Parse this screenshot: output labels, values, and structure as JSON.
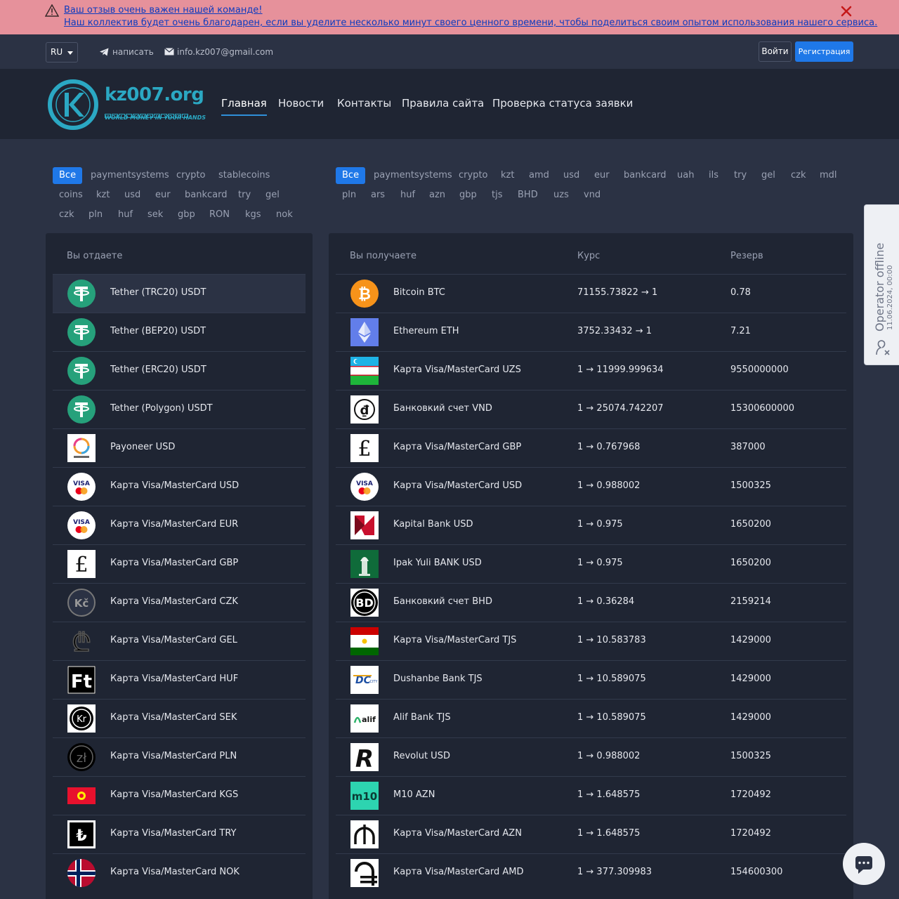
{
  "alert": {
    "line1": "Ваш отзыв очень важен нашей команде!",
    "line2": "Наш коллектив будет очень благодарен, если вы уделите несколько минут своего ценного времени, чтобы поделиться своим опытом использования нашего сервиса."
  },
  "topbar": {
    "lang": "RU",
    "write": "написать",
    "email": "info.kz007@gmail.com",
    "login": "Войти",
    "register": "Регистрация"
  },
  "logo": {
    "name": "kz007.org",
    "slogan": "WORLD MONEY IN YOUR HANDS"
  },
  "nav": [
    "Главная",
    "Новости",
    "Контакты",
    "Правила сайта",
    "Проверка статуса заявки"
  ],
  "filters_left": [
    "Все",
    "paymentsystems",
    "crypto",
    "stablecoins",
    "coins",
    "kzt",
    "usd",
    "eur",
    "bankcard",
    "try",
    "gel",
    "czk",
    "pln",
    "huf",
    "sek",
    "gbp",
    "RON",
    "kgs",
    "nok"
  ],
  "filters_right": [
    "Все",
    "paymentsystems",
    "crypto",
    "kzt",
    "amd",
    "usd",
    "eur",
    "bankcard",
    "uah",
    "ils",
    "try",
    "gel",
    "czk",
    "mdl",
    "pln",
    "ars",
    "huf",
    "azn",
    "gbp",
    "tjs",
    "BHD",
    "uzs",
    "vnd"
  ],
  "give": {
    "header": "Вы отдаете",
    "items": [
      "Tether (TRC20) USDT",
      "Tether (BEP20) USDT",
      "Tether (ERC20) USDT",
      "Tether (Polygon) USDT",
      "Payoneer USD",
      "Карта Visa/MasterCard USD",
      "Карта Visa/MasterCard EUR",
      "Карта Visa/MasterCard GBP",
      "Карта Visa/MasterCard CZK",
      "Карта Visa/MasterCard GEL",
      "Карта Visa/MasterCard HUF",
      "Карта Visa/MasterCard SEK",
      "Карта Visa/MasterCard PLN",
      "Карта Visa/MasterCard KGS",
      "Карта Visa/MasterCard TRY",
      "Карта Visa/MasterCard NOK"
    ]
  },
  "receive": {
    "header_name": "Вы получаете",
    "header_rate": "Курс",
    "header_reserve": "Резерв",
    "rows": [
      {
        "name": "Bitcoin BTC",
        "rate": "71155.73822 → 1",
        "reserve": "0.78"
      },
      {
        "name": "Ethereum ETH",
        "rate": "3752.33432 → 1",
        "reserve": "7.21"
      },
      {
        "name": "Карта Visa/MasterCard UZS",
        "rate": "1 → 11999.999634",
        "reserve": "9550000000"
      },
      {
        "name": "Банковкий счет VND",
        "rate": "1 → 25074.742207",
        "reserve": "15300600000"
      },
      {
        "name": "Карта Visa/MasterCard GBP",
        "rate": "1 → 0.767968",
        "reserve": "387000"
      },
      {
        "name": "Карта Visa/MasterCard USD",
        "rate": "1 → 0.988002",
        "reserve": "1500325"
      },
      {
        "name": "Kapital Bank USD",
        "rate": "1 → 0.975",
        "reserve": "1650200"
      },
      {
        "name": "Ipak Yuli BANK USD",
        "rate": "1 → 0.975",
        "reserve": "1650200"
      },
      {
        "name": "Банковкий счет BHD",
        "rate": "1 → 0.36284",
        "reserve": "2159214"
      },
      {
        "name": "Карта Visa/MasterCard TJS",
        "rate": "1 → 10.583783",
        "reserve": "1429000"
      },
      {
        "name": "Dushanbe Bank TJS",
        "rate": "1 → 10.589075",
        "reserve": "1429000"
      },
      {
        "name": "Alif Bank TJS",
        "rate": "1 → 10.589075",
        "reserve": "1429000"
      },
      {
        "name": "Revolut USD",
        "rate": "1 → 0.988002",
        "reserve": "1500325"
      },
      {
        "name": "M10 AZN",
        "rate": "1 → 1.648575",
        "reserve": "1720492"
      },
      {
        "name": "Карта Visa/MasterCard AZN",
        "rate": "1 → 1.648575",
        "reserve": "1720492"
      },
      {
        "name": "Карта Visa/MasterCard AMD",
        "rate": "1 → 377.309983",
        "reserve": "154600300"
      }
    ]
  },
  "operator": {
    "status": "Operator offline",
    "date": "11.06.2024, 00:00"
  },
  "colors": {
    "accent": "#1f78e8",
    "brand": "#2ba8c3",
    "alert_bg": "#e6919b",
    "panel_bg": "#1f2533",
    "page_bg": "#2b3244"
  }
}
